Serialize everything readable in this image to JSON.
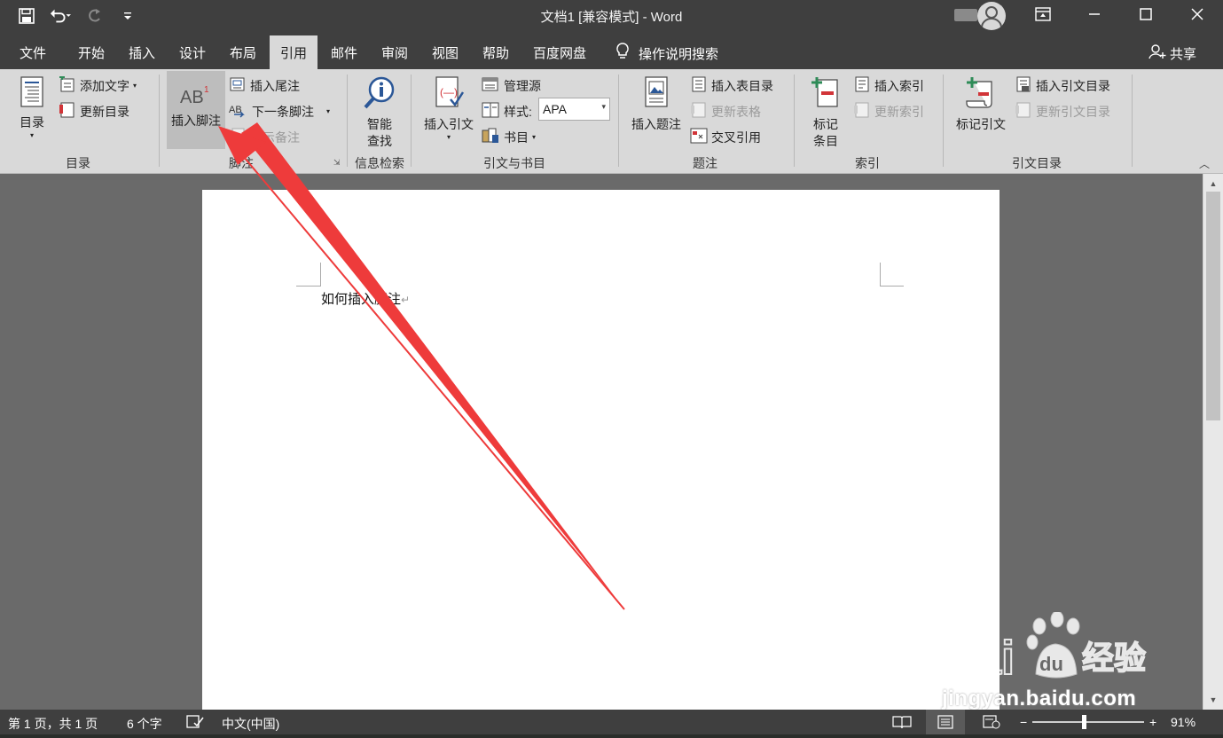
{
  "window": {
    "title": "文档1 [兼容模式]  -  Word"
  },
  "menu_tabs": [
    {
      "label": "文件"
    },
    {
      "label": "开始"
    },
    {
      "label": "插入"
    },
    {
      "label": "设计"
    },
    {
      "label": "布局"
    },
    {
      "label": "引用",
      "active": true
    },
    {
      "label": "邮件"
    },
    {
      "label": "审阅"
    },
    {
      "label": "视图"
    },
    {
      "label": "帮助"
    },
    {
      "label": "百度网盘"
    }
  ],
  "tell_me": "操作说明搜索",
  "share": "共享",
  "ribbon": {
    "toc": {
      "group_label": "目录",
      "toc_button": "目录",
      "add_text": "添加文字",
      "update_toc": "更新目录"
    },
    "footnotes": {
      "group_label": "脚注",
      "insert_footnote": "插入脚注",
      "insert_endnote": "插入尾注",
      "next_footnote": "下一条脚注",
      "show_notes": "显示备注"
    },
    "research": {
      "group_label": "信息检索",
      "smart_lookup_1": "智能",
      "smart_lookup_2": "查找"
    },
    "citations": {
      "group_label": "引文与书目",
      "insert_citation": "插入引文",
      "manage_sources": "管理源",
      "style_label": "样式:",
      "style_value": "APA",
      "bibliography": "书目"
    },
    "captions": {
      "group_label": "题注",
      "insert_caption": "插入题注",
      "insert_table_of_figures": "插入表目录",
      "update_table": "更新表格",
      "cross_reference": "交叉引用"
    },
    "index": {
      "group_label": "索引",
      "mark_entry_1": "标记",
      "mark_entry_2": "条目",
      "insert_index": "插入索引",
      "update_index": "更新索引"
    },
    "authorities": {
      "group_label": "引文目录",
      "mark_citation": "标记引文",
      "insert_toa": "插入引文目录",
      "update_toa": "更新引文目录"
    }
  },
  "document": {
    "text": "如何插入脚注",
    "para_mark": "↵"
  },
  "status": {
    "page": "第 1 页，共 1 页",
    "words": "6 个字",
    "language": "中文(中国)",
    "zoom": "91%",
    "zoom_minus": "−",
    "zoom_plus": "+"
  },
  "watermark": {
    "url": "jingyan.baidu.com",
    "brand": "Bai",
    "brand2": "du",
    "cn": "经验"
  },
  "colors": {
    "titlebar": "#3f3f3f",
    "ribbon": "#d9d9d9",
    "annotation_arrow": "#ee3b3b"
  }
}
